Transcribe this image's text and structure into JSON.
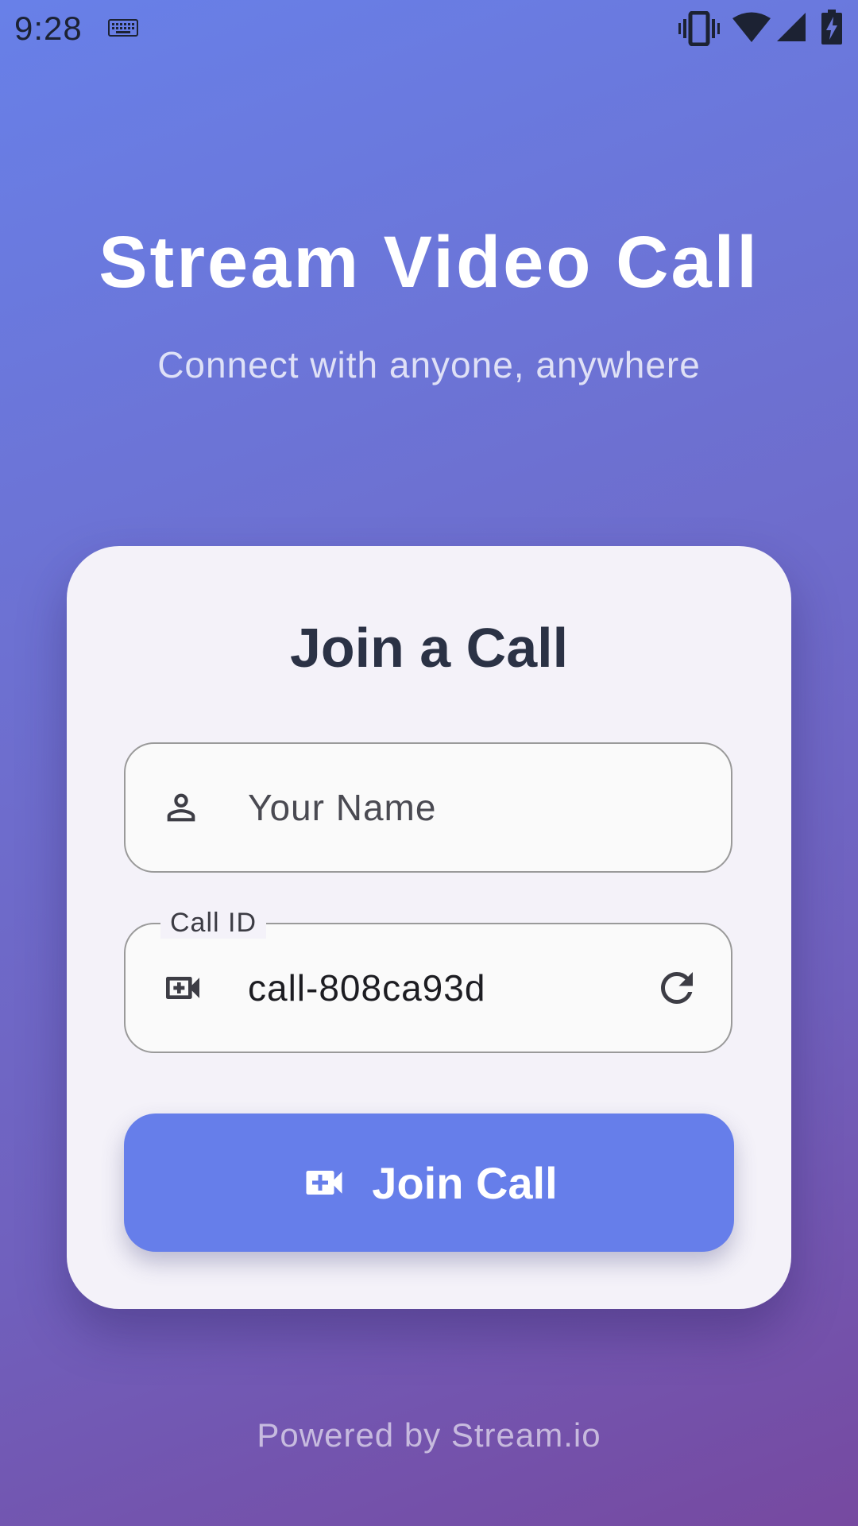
{
  "status_bar": {
    "time": "9:28",
    "icons": [
      "keyboard-icon",
      "vibrate-icon",
      "wifi-icon",
      "signal-icon",
      "battery-charging-icon"
    ]
  },
  "header": {
    "title": "Stream Video Call",
    "subtitle": "Connect with anyone, anywhere"
  },
  "card": {
    "title": "Join a Call",
    "name_field": {
      "placeholder": "Your Name",
      "value": "",
      "icon": "person-icon"
    },
    "call_id_field": {
      "label": "Call ID",
      "value": "call-808ca93d",
      "icon": "video-call-icon",
      "action_icon": "refresh-icon"
    },
    "join_button": {
      "label": "Join Call",
      "icon": "video-call-icon"
    }
  },
  "footer": {
    "text": "Powered by Stream.io"
  },
  "colors": {
    "accent": "#667eea",
    "card_background": "#f4f2f9",
    "title_text": "#2b3245",
    "gradient_start": "#6880e8",
    "gradient_end": "#7649a0"
  }
}
